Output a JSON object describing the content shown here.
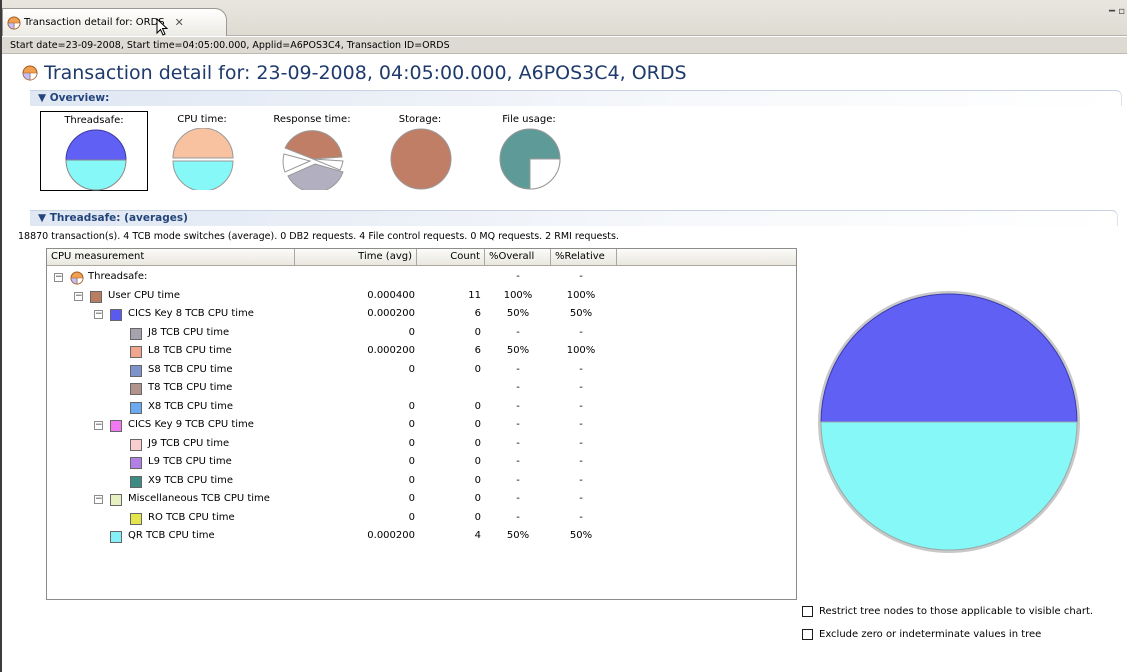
{
  "tab": {
    "title": "Transaction detail for: ORDS",
    "close_glyph": "✕",
    "window_controls": "━ ▫"
  },
  "info_line": "Start date=23-09-2008, Start time=04:05:00.000, Applid=A6POS3C4, Transaction ID=ORDS",
  "page_title": "Transaction detail for: 23-09-2008, 04:05:00.000, A6POS3C4, ORDS",
  "overview": {
    "heading": "Overview:",
    "thumbs": [
      {
        "label": "Threadsafe:",
        "selected": true
      },
      {
        "label": "CPU time:",
        "selected": false
      },
      {
        "label": "Response time:",
        "selected": false
      },
      {
        "label": "Storage:",
        "selected": false
      },
      {
        "label": "File usage:",
        "selected": false
      }
    ]
  },
  "threadsafe": {
    "heading": "Threadsafe: (averages)",
    "summary": "18870 transaction(s). 4 TCB mode switches (average). 0 DB2 requests. 4 File control requests. 0 MQ requests. 2 RMI requests."
  },
  "table": {
    "columns": [
      "CPU measurement",
      "Time (avg)",
      "Count",
      "%Overall",
      "%Relative"
    ],
    "rows": [
      {
        "level": 0,
        "expander": "−",
        "icon": "threadsafe-pie-icon",
        "color": null,
        "name": "Threadsafe:",
        "time": "",
        "count": "",
        "overall": "-",
        "relative": "-"
      },
      {
        "level": 1,
        "expander": "−",
        "icon": null,
        "color": "#b87e62",
        "name": "User CPU time",
        "time": "0.000400",
        "count": "11",
        "overall": "100%",
        "relative": "100%"
      },
      {
        "level": 2,
        "expander": "−",
        "icon": null,
        "color": "#5a5af0",
        "name": "CICS Key 8 TCB CPU time",
        "time": "0.000200",
        "count": "6",
        "overall": "50%",
        "relative": "50%"
      },
      {
        "level": 3,
        "expander": null,
        "icon": null,
        "color": "#a6a3ae",
        "name": "J8 TCB CPU time",
        "time": "0",
        "count": "0",
        "overall": "-",
        "relative": "-"
      },
      {
        "level": 3,
        "expander": null,
        "icon": null,
        "color": "#f2a58e",
        "name": "L8 TCB CPU time",
        "time": "0.000200",
        "count": "6",
        "overall": "50%",
        "relative": "100%"
      },
      {
        "level": 3,
        "expander": null,
        "icon": null,
        "color": "#7e92cc",
        "name": "S8 TCB CPU time",
        "time": "0",
        "count": "0",
        "overall": "-",
        "relative": "-"
      },
      {
        "level": 3,
        "expander": null,
        "icon": null,
        "color": "#b2948c",
        "name": "T8 TCB CPU time",
        "time": "",
        "count": "",
        "overall": "-",
        "relative": "-"
      },
      {
        "level": 3,
        "expander": null,
        "icon": null,
        "color": "#6aaaf0",
        "name": "X8 TCB CPU time",
        "time": "0",
        "count": "0",
        "overall": "-",
        "relative": "-"
      },
      {
        "level": 2,
        "expander": "−",
        "icon": null,
        "color": "#f078f0",
        "name": "CICS Key 9 TCB CPU time",
        "time": "0",
        "count": "0",
        "overall": "-",
        "relative": "-"
      },
      {
        "level": 3,
        "expander": null,
        "icon": null,
        "color": "#f8cece",
        "name": "J9 TCB CPU time",
        "time": "0",
        "count": "0",
        "overall": "-",
        "relative": "-"
      },
      {
        "level": 3,
        "expander": null,
        "icon": null,
        "color": "#b080e6",
        "name": "L9 TCB CPU time",
        "time": "0",
        "count": "0",
        "overall": "-",
        "relative": "-"
      },
      {
        "level": 3,
        "expander": null,
        "icon": null,
        "color": "#3d8c84",
        "name": "X9 TCB CPU time",
        "time": "0",
        "count": "0",
        "overall": "-",
        "relative": "-"
      },
      {
        "level": 2,
        "expander": "−",
        "icon": null,
        "color": "#e6f0c0",
        "name": "Miscellaneous TCB CPU time",
        "time": "0",
        "count": "0",
        "overall": "-",
        "relative": "-"
      },
      {
        "level": 3,
        "expander": null,
        "icon": null,
        "color": "#e4e44c",
        "name": "RO TCB CPU time",
        "time": "0",
        "count": "0",
        "overall": "-",
        "relative": "-"
      },
      {
        "level": 2,
        "expander": null,
        "icon": null,
        "color": "#86f0f8",
        "name": "QR TCB CPU time",
        "time": "0.000200",
        "count": "4",
        "overall": "50%",
        "relative": "50%"
      }
    ]
  },
  "chart_data": {
    "type": "pie",
    "slices": [
      {
        "label": "CICS Key 8 TCB CPU time",
        "value": 50,
        "color": "#6060f4"
      },
      {
        "label": "QR TCB CPU time",
        "value": 50,
        "color": "#86f8f8"
      }
    ]
  },
  "options": [
    {
      "label": "Restrict tree nodes to those applicable to visible chart.",
      "checked": false
    },
    {
      "label": "Exclude zero or indeterminate values in tree",
      "checked": false
    }
  ],
  "colors": {
    "title_blue": "#1f3a6c",
    "section_blue": "#23447a",
    "threadsafe_top": "#6060f4",
    "threadsafe_bottom": "#86f8f8",
    "cpu_top": "#f8c2a0",
    "storage": "#c07e66",
    "file_usage": "#5e9a98"
  }
}
